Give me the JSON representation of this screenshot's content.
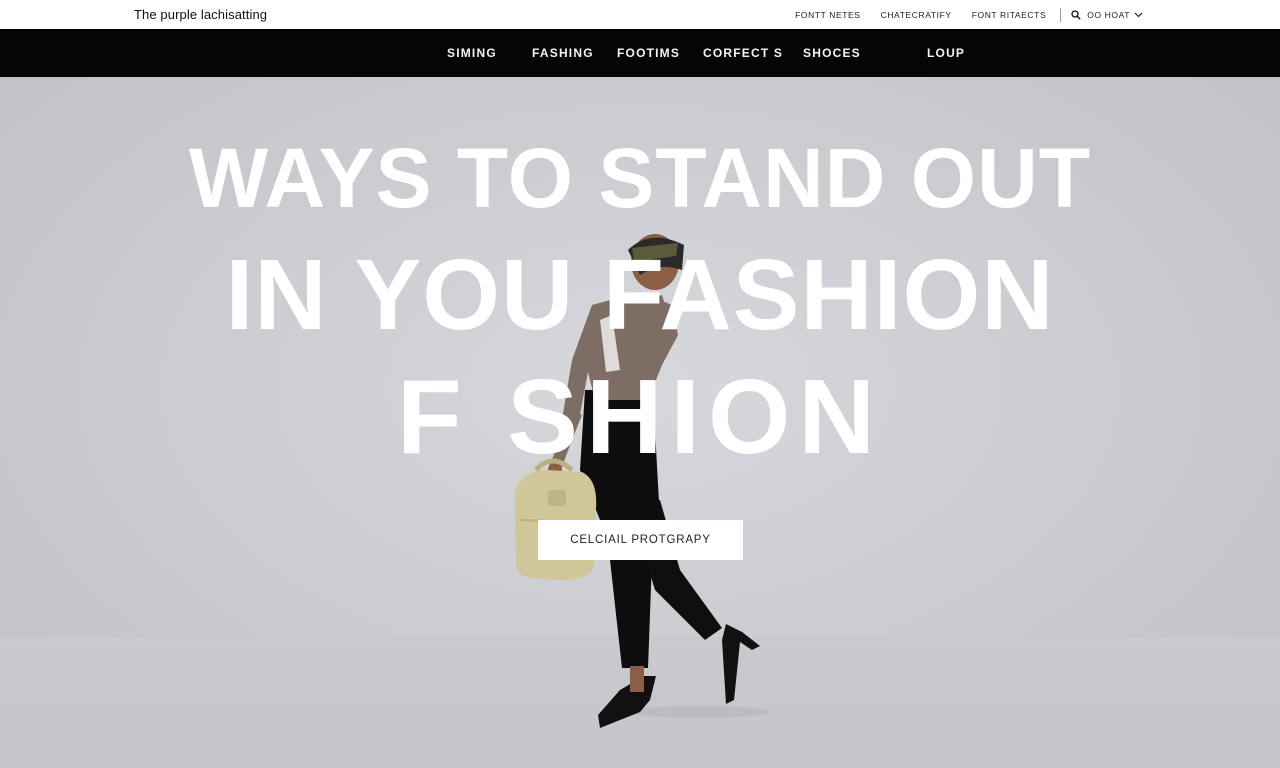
{
  "header": {
    "brand": "The purple lachisatting",
    "utility_links": [
      "FONTT NETES",
      "CHATECRATIFY",
      "FONT RITAECTS"
    ],
    "search_label": "OO HOAT"
  },
  "nav": {
    "items": [
      "SIMING",
      "FASHING",
      "FOOTIMS",
      "CORFECT S",
      "SHOCES",
      "LOUP"
    ]
  },
  "hero": {
    "headline_line1": "WAYS TO STAND OUT",
    "headline_line2": "IN YOU FASHION",
    "headline_line3": "F  SHION",
    "cta_label": "CELCIAIL PROTGRAPY"
  },
  "colors": {
    "nav_bg": "#050505",
    "hero_bg": "#c9cbcf",
    "bag": "#cfc69a"
  }
}
